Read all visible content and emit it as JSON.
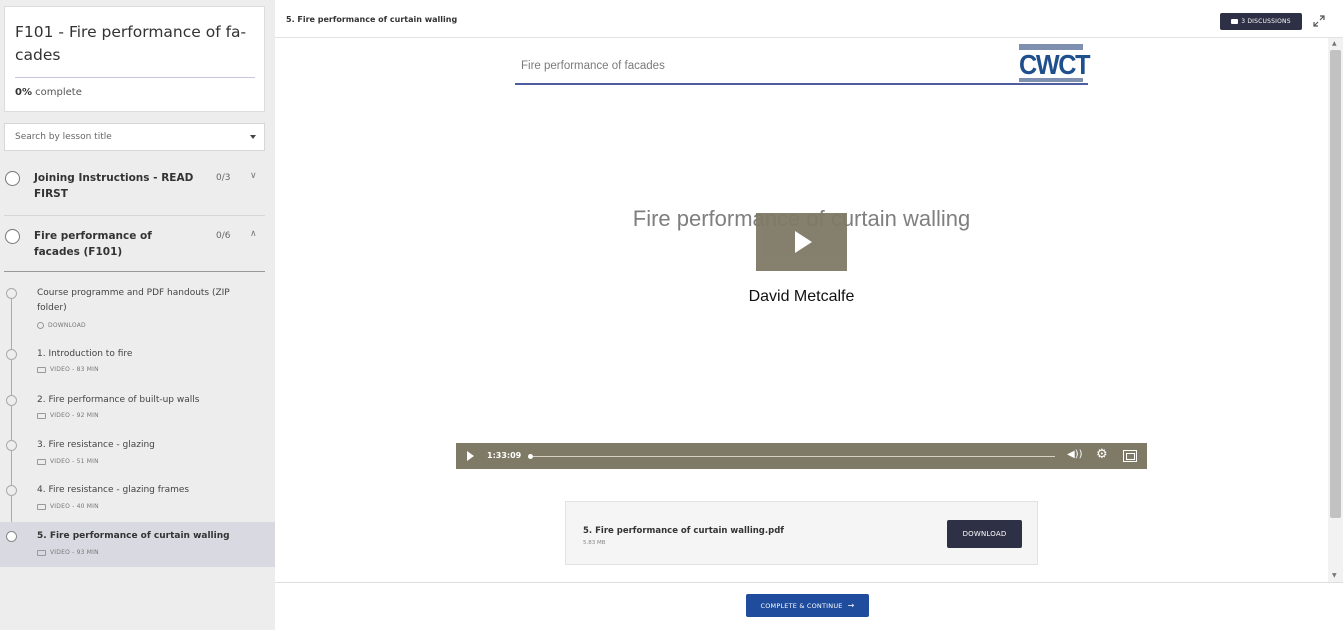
{
  "course": {
    "title": "F101 - Fire performance of fa-cades",
    "progress_percent": "0%",
    "progress_suffix": " complete"
  },
  "search": {
    "placeholder": "Search by lesson title"
  },
  "sections": [
    {
      "title": "Joining Instructions - READ FIRST",
      "count": "0/3",
      "expanded": false
    },
    {
      "title": "Fire performance of facades (F101)",
      "count": "0/6",
      "expanded": true
    }
  ],
  "lessons": [
    {
      "title": "Course programme and PDF handouts (ZIP folder)",
      "meta": "DOWNLOAD",
      "icon": "download-icon",
      "active": false
    },
    {
      "title": "1. Introduction to fire",
      "meta": "VIDEO - 83 MIN",
      "icon": "video-icon",
      "active": false
    },
    {
      "title": "2. Fire performance of built-up walls",
      "meta": "VIDEO - 92 MIN",
      "icon": "video-icon",
      "active": false
    },
    {
      "title": "3. Fire resistance - glazing",
      "meta": "VIDEO - 51 MIN",
      "icon": "video-icon",
      "active": false
    },
    {
      "title": "4. Fire resistance - glazing frames",
      "meta": "VIDEO - 40 MIN",
      "icon": "video-icon",
      "active": false
    },
    {
      "title": "5. Fire performance of curtain walling",
      "meta": "VIDEO - 93 MIN",
      "icon": "video-icon",
      "active": true
    }
  ],
  "header": {
    "lesson_title": "5. Fire performance of curtain walling",
    "discussions_label": "3 DISCUSSIONS"
  },
  "video": {
    "slide_header": "Fire performance of facades",
    "logo_text": "CWCT",
    "slide_title": "Fire performance of curtain walling",
    "presenter": "David Metcalfe",
    "time": "1:33:09",
    "progress": 0
  },
  "attachment": {
    "file_name": "5. Fire performance of curtain walling.pdf",
    "file_size": "5.83 MB",
    "download_label": "DOWNLOAD"
  },
  "footer": {
    "complete_label": "COMPLETE & CONTINUE",
    "arrow": "→"
  },
  "colors": {
    "accent_blue": "#1f4c9c",
    "dark_button": "#2e3145",
    "player_bar": "#7e7a66",
    "active_lesson_bg": "#d9d9e1"
  }
}
